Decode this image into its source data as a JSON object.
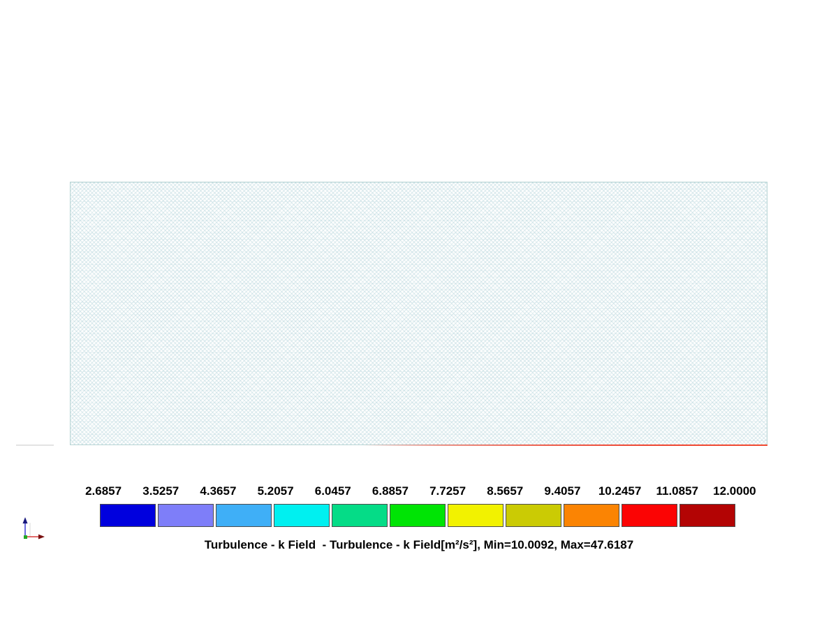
{
  "viewport": {
    "background_color": "#ffffff",
    "mesh_border_color": "#b7d4d4",
    "heated_edge_color": "#ee4530"
  },
  "triad": {
    "x_axis_color": "#d93a3a",
    "x_axis_head_color": "#7a1010",
    "z_axis_color": "#4747d6",
    "z_axis_head_color": "#17177d",
    "origin_color": "#22a822"
  },
  "legend": {
    "tick_labels": [
      "2.6857",
      "3.5257",
      "4.3657",
      "5.2057",
      "6.0457",
      "6.8857",
      "7.7257",
      "8.5657",
      "9.4057",
      "10.2457",
      "11.0857",
      "12.0000"
    ],
    "swatches": [
      "#0000DE",
      "#7E7EF9",
      "#3FAFF7",
      "#00F0F0",
      "#05DC87",
      "#00E405",
      "#F2F200",
      "#CBCB04",
      "#FB8403",
      "#FB0404",
      "#B30404"
    ],
    "caption": "Turbulence - k Field  - Turbulence - k Field[m²/s²], Min=10.0092, Max=47.6187",
    "min": "10.0092",
    "max": "47.6187",
    "units": "m²/s²"
  }
}
